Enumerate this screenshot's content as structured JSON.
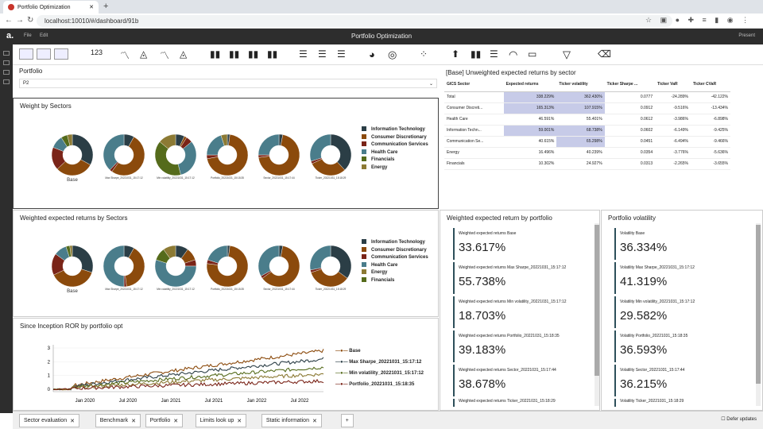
{
  "browser": {
    "tab_title": "Portfolio Optimization",
    "url": "localhost:10010/#/dashboard/91b",
    "new_tab": "+"
  },
  "app": {
    "logo": "a.",
    "menu": [
      "File",
      "Edit"
    ],
    "title": "Portfolio Optimization",
    "present": "Present"
  },
  "portfolio": {
    "label": "Portfolio",
    "value": "P2"
  },
  "colors": {
    "it": "#2b3e46",
    "cd": "#8b4a0c",
    "cs": "#7a2418",
    "hc": "#4a7d8b",
    "fin": "#556b1b",
    "en": "#8c7a34"
  },
  "sectors": {
    "legend": [
      "Information Technology",
      "Consumer Discretionary",
      "Communication Services",
      "Health Care",
      "Financials",
      "Energy"
    ],
    "title": "Weight by Sectors",
    "donut_labels": [
      "Base",
      "Max Sharpe_20221031_15:17:12",
      "Min volatility_20221031_15:17:12",
      "Portfolio_20221031_15:18:35",
      "Sector_20221031_15:17:44",
      "Ticker_20221031_15:18:29"
    ],
    "shares": [
      [
        0.33,
        0.3,
        0.18,
        0.1,
        0.05,
        0.04
      ],
      [
        0.08,
        0.52,
        0.02,
        0.38,
        0.0,
        0.0
      ],
      [
        0.07,
        0.02,
        0.05,
        0.32,
        0.4,
        0.14
      ],
      [
        0.02,
        0.7,
        0.03,
        0.2,
        0.0,
        0.05
      ],
      [
        0.03,
        0.7,
        0.02,
        0.25,
        0.0,
        0.0
      ],
      [
        0.38,
        0.3,
        0.02,
        0.3,
        0.0,
        0.0
      ]
    ]
  },
  "weighted_sectors": {
    "title": "Weighted expected returns by Sectors",
    "legend": [
      "Information Technology",
      "Consumer Discretionary",
      "Communication Services",
      "Health Care",
      "Energy",
      "Financials"
    ],
    "donut_labels": [
      "Base",
      "Max Sharpe_20221031_15:17:12",
      "Min volatility_20221031_15:17:12",
      "Portfolio_20221031_15:18:35",
      "Sector_20221031_15:17:44",
      "Ticker_20221031_15:18:29"
    ],
    "shares": [
      [
        0.3,
        0.38,
        0.17,
        0.1,
        0.03,
        0.02
      ],
      [
        0.08,
        0.4,
        0.02,
        0.5,
        0.0,
        0.0
      ],
      [
        0.1,
        0.1,
        0.05,
        0.55,
        0.1,
        0.1
      ],
      [
        0.02,
        0.75,
        0.03,
        0.2,
        0.0,
        0.0
      ],
      [
        0.03,
        0.62,
        0.02,
        0.33,
        0.0,
        0.0
      ],
      [
        0.35,
        0.35,
        0.02,
        0.28,
        0.0,
        0.0
      ]
    ]
  },
  "ror": {
    "title": "Since Inception ROR by portfolio opt",
    "legend": [
      "Base",
      "Max Sharpe_20221031_15:17:12",
      "Min volatility_20221031_15:17:12",
      "Portfolio_20221031_15:18:35"
    ],
    "legend_colors": [
      "#8b4a0c",
      "#2b3e46",
      "#556b1b",
      "#7a2418"
    ],
    "yticks": [
      "3",
      "2",
      "1",
      "0"
    ],
    "xticks": [
      "Jan 2020",
      "Jul 2020",
      "Jan 2021",
      "Jul 2021",
      "Jan 2022",
      "Jul 2022"
    ]
  },
  "table": {
    "title": "[Base] Unweighted expected returns by sector",
    "headers": [
      "GICS Sector",
      "Expected returns",
      "Ticker volatility",
      "Ticker Sharpe ...",
      "Ticker VaR",
      "Ticker CVaR"
    ],
    "rows": [
      [
        "Total",
        "338.229%",
        "362.430%",
        "0.0777",
        "-24.289%",
        "-42.122%"
      ],
      [
        "Consumer Discreti...",
        "165.313%",
        "107.915%",
        "0.0912",
        "-9.516%",
        "-13.434%"
      ],
      [
        "Health Care",
        "46.591%",
        "55.401%",
        "0.0612",
        "-3.986%",
        "-6.898%"
      ],
      [
        "Information Techn...",
        "59.001%",
        "68.738%",
        "0.0602",
        "-6.149%",
        "-9.425%"
      ],
      [
        "Communication Se...",
        "40.615%",
        "65.298%",
        "0.0451",
        "-6.494%",
        "-9.466%"
      ],
      [
        "Energy",
        "16.496%",
        "40.239%",
        "0.0354",
        "-3.776%",
        "-5.636%"
      ],
      [
        "Financials",
        "10.302%",
        "24.927%",
        "0.0313",
        "-2.265%",
        "-3.655%"
      ]
    ]
  },
  "weighted_return": {
    "title": "Weighted expected return by portfolio",
    "cards": [
      {
        "label": "Weighted expected returns Base",
        "value": "33.617%"
      },
      {
        "label": "Weighted expected returns Max Sharpe_20221031_15:17:12",
        "value": "55.738%"
      },
      {
        "label": "Weighted expected returns Min volatility_20221031_15:17:12",
        "value": "18.703%"
      },
      {
        "label": "Weighted expected returns Portfolio_20221031_15:18:35",
        "value": "39.183%"
      },
      {
        "label": "Weighted expected returns Sector_20221031_15:17:44",
        "value": "38.678%"
      }
    ],
    "partial": "Weighted expected returns Ticker_20221031_15:18:29"
  },
  "volatility": {
    "title": "Portfolio volatility",
    "cards": [
      {
        "label": "Volatility Base",
        "value": "36.334%"
      },
      {
        "label": "Volatility Max Sharpe_20221031_15:17:12",
        "value": "41.319%"
      },
      {
        "label": "Volatility Min volatility_20221031_15:17:12",
        "value": "29.582%"
      },
      {
        "label": "Volatility Portfolio_20221031_15:18:35",
        "value": "36.593%"
      },
      {
        "label": "Volatility Sector_20221031_15:17:44",
        "value": "36.215%"
      }
    ],
    "partial": "Volatility Ticker_20221031_15:18:29"
  },
  "bottom_tabs": [
    "Sector evaluation",
    "Benchmark",
    "Portfolio",
    "Limits look up",
    "Static information"
  ],
  "defer": "Defer updates"
}
